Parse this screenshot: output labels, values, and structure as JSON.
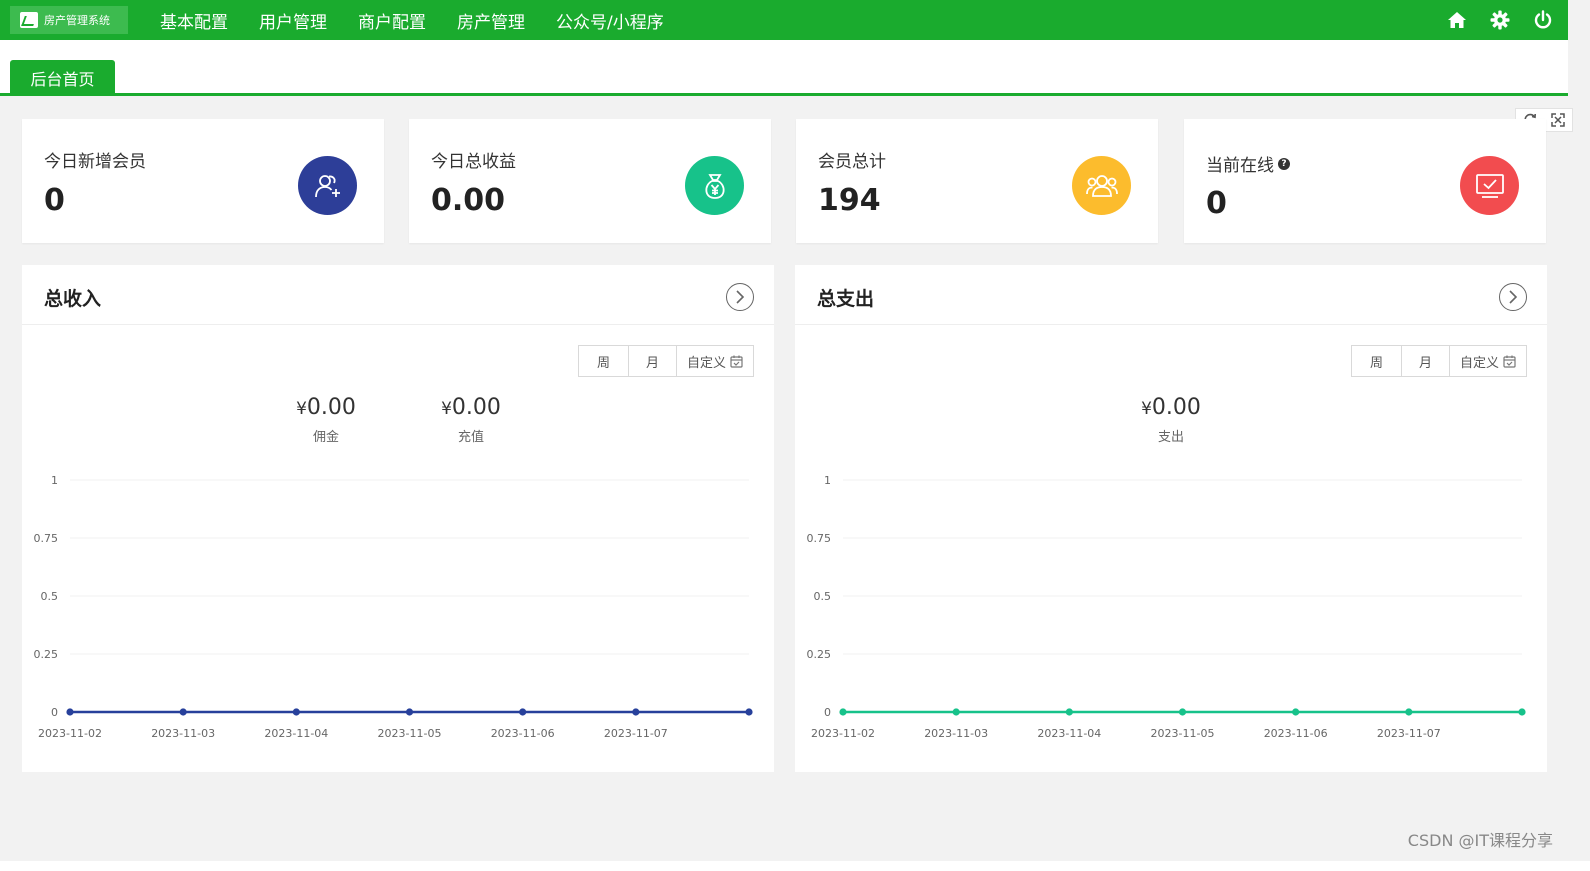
{
  "app": {
    "logo_text": "房产管理系统"
  },
  "nav": [
    "基本配置",
    "用户管理",
    "商户配置",
    "房产管理",
    "公众号/小程序"
  ],
  "top_icons": [
    "home-icon",
    "gear-icon",
    "power-icon"
  ],
  "tabs": [
    {
      "label": "后台首页"
    }
  ],
  "tab_tools": [
    "refresh-icon",
    "fullscreen-icon"
  ],
  "stats": [
    {
      "label": "今日新增会员",
      "value": "0",
      "icon": "add-user-icon",
      "color": "#2d3e98"
    },
    {
      "label": "今日总收益",
      "value": "0.00",
      "icon": "money-bag-icon",
      "color": "#17c28a"
    },
    {
      "label": "会员总计",
      "value": "194",
      "icon": "group-icon",
      "color": "#fcbc2d"
    },
    {
      "label": "当前在线",
      "value": "0",
      "icon": "monitor-icon",
      "color": "#f24c4f"
    }
  ],
  "income": {
    "title": "总收入",
    "range_buttons": [
      "周",
      "月",
      "自定义"
    ],
    "summary": [
      {
        "currency": "¥",
        "value": "0.00",
        "label": "佣金"
      },
      {
        "currency": "¥",
        "value": "0.00",
        "label": "充值"
      }
    ]
  },
  "expense": {
    "title": "总支出",
    "range_buttons": [
      "周",
      "月",
      "自定义"
    ],
    "summary": [
      {
        "currency": "¥",
        "value": "0.00",
        "label": "支出"
      }
    ]
  },
  "chart_data": [
    {
      "type": "line",
      "x": [
        "2023-11-02",
        "2023-11-03",
        "2023-11-04",
        "2023-11-05",
        "2023-11-06",
        "2023-11-07",
        ""
      ],
      "series": [
        {
          "values": [
            0,
            0,
            0,
            0,
            0,
            0,
            0
          ],
          "color": "#27409b"
        }
      ],
      "yticks": [
        "1",
        "0.75",
        "0.5",
        "0.25",
        "0"
      ],
      "ylim": [
        0,
        1
      ],
      "grid": true
    },
    {
      "type": "line",
      "x": [
        "2023-11-02",
        "2023-11-03",
        "2023-11-04",
        "2023-11-05",
        "2023-11-06",
        "2023-11-07",
        ""
      ],
      "series": [
        {
          "values": [
            0,
            0,
            0,
            0,
            0,
            0,
            0
          ],
          "color": "#17c28a"
        }
      ],
      "yticks": [
        "1",
        "0.75",
        "0.5",
        "0.25",
        "0"
      ],
      "ylim": [
        0,
        1
      ],
      "grid": true
    }
  ],
  "watermark": "CSDN @IT课程分享"
}
